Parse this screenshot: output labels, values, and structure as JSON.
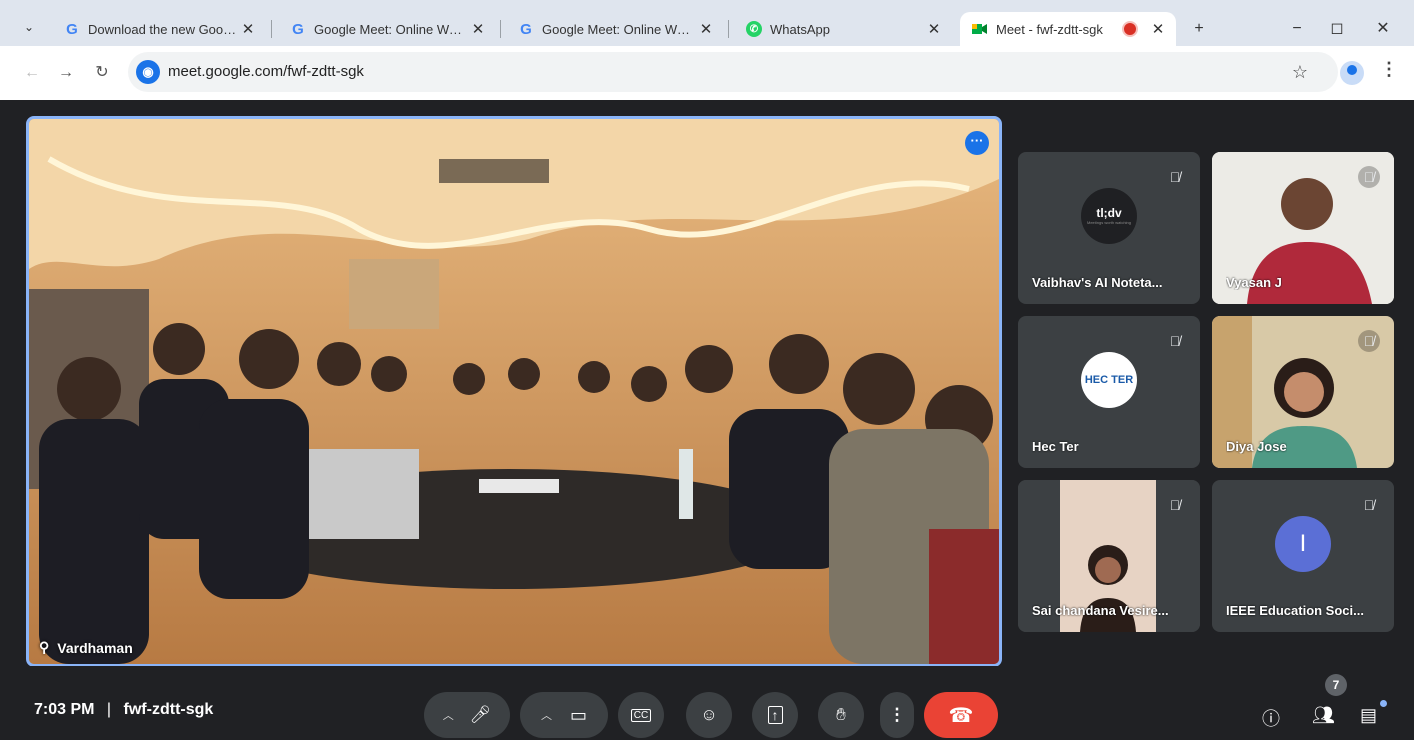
{
  "browser": {
    "tabs": [
      {
        "title": "Download the new Google M...",
        "icon": "google-g-icon"
      },
      {
        "title": "Google Meet: Online Web an...",
        "icon": "google-g-icon"
      },
      {
        "title": "Google Meet: Online Web an...",
        "icon": "google-g-icon"
      },
      {
        "title": "WhatsApp",
        "icon": "whatsapp-icon"
      },
      {
        "title": "Meet - fwf-zdtt-sgk",
        "icon": "meet-icon",
        "active": true
      }
    ],
    "url": "meet.google.com/fwf-zdtt-sgk",
    "new_tab": "+",
    "minimize": "−",
    "maximize": "◻",
    "close": "✕"
  },
  "meeting": {
    "main_speaker": "Vardhaman",
    "participants": [
      {
        "name": "Vaibhav's AI Noteta...",
        "avatar_text": "tl;dv",
        "avatar_subtext": "Meetings worth watching",
        "avatar_color": "#1f2023"
      },
      {
        "name": "Vyasan J",
        "video": true
      },
      {
        "name": "Hec Ter",
        "avatar_text": "HEC TER",
        "avatar_color": "#ffffff"
      },
      {
        "name": "Diya Jose",
        "video": true
      },
      {
        "name": "Sai chandana Vesire...",
        "video": true
      },
      {
        "name": "IEEE Education Soci...",
        "avatar_text": "I",
        "avatar_color": "#5b6fd6"
      }
    ],
    "time": "7:03 PM",
    "separator": "|",
    "code": "fwf-zdtt-sgk",
    "people_count": "7"
  },
  "colors": {
    "meet_bg": "#202124",
    "tile_bg": "#3c4043",
    "active_border": "#8ab4f8",
    "end_call": "#ea4335",
    "accent": "#1a73e8"
  }
}
